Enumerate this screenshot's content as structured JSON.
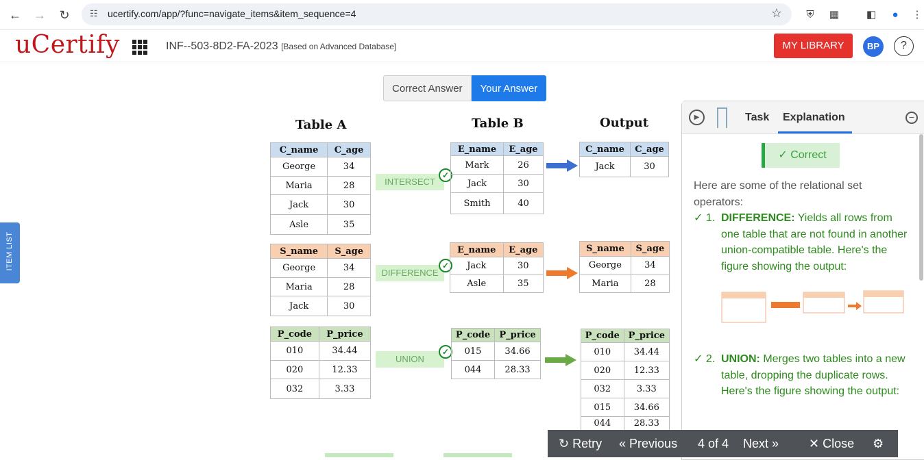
{
  "browser": {
    "url": "ucertify.com/app/?func=navigate_items&item_sequence=4"
  },
  "header": {
    "logo": "uCertify",
    "course_code": "INF--503-8D2-FA-2023",
    "course_note": "[Based on Advanced Database]",
    "my_library": "MY LIBRARY",
    "avatar": "BP",
    "help": "?"
  },
  "sidebar": {
    "item_list": "ITEM LIST"
  },
  "toggle": {
    "correct_answer": "Correct Answer",
    "your_answer": "Your Answer"
  },
  "diagram": {
    "titles": {
      "a": "Table A",
      "b": "Table B",
      "out": "Output"
    },
    "intersect": {
      "op": "INTERSECT",
      "a": {
        "headers": [
          "C_name",
          "C_age"
        ],
        "rows": [
          [
            "George",
            "34"
          ],
          [
            "Maria",
            "28"
          ],
          [
            "Jack",
            "30"
          ],
          [
            "Asle",
            "35"
          ]
        ]
      },
      "b": {
        "headers": [
          "E_name",
          "E_age"
        ],
        "rows": [
          [
            "Mark",
            "26"
          ],
          [
            "Jack",
            "30"
          ],
          [
            "Smith",
            "40"
          ]
        ]
      },
      "out": {
        "headers": [
          "C_name",
          "C_age"
        ],
        "rows": [
          [
            "Jack",
            "30"
          ]
        ]
      }
    },
    "difference": {
      "op": "DIFFERENCE",
      "a": {
        "headers": [
          "S_name",
          "S_age"
        ],
        "rows": [
          [
            "George",
            "34"
          ],
          [
            "Maria",
            "28"
          ],
          [
            "Jack",
            "30"
          ]
        ]
      },
      "b": {
        "headers": [
          "E_name",
          "E_age"
        ],
        "rows": [
          [
            "Jack",
            "30"
          ],
          [
            "Asle",
            "35"
          ]
        ]
      },
      "out": {
        "headers": [
          "S_name",
          "S_age"
        ],
        "rows": [
          [
            "George",
            "34"
          ],
          [
            "Maria",
            "28"
          ]
        ]
      }
    },
    "union": {
      "op": "UNION",
      "a": {
        "headers": [
          "P_code",
          "P_price"
        ],
        "rows": [
          [
            "010",
            "34.44"
          ],
          [
            "020",
            "12.33"
          ],
          [
            "032",
            "3.33"
          ]
        ]
      },
      "b": {
        "headers": [
          "P_code",
          "P_price"
        ],
        "rows": [
          [
            "015",
            "34.66"
          ],
          [
            "044",
            "28.33"
          ]
        ]
      },
      "out": {
        "headers": [
          "P_code",
          "P_price"
        ],
        "rows": [
          [
            "010",
            "34.44"
          ],
          [
            "020",
            "12.33"
          ],
          [
            "032",
            "3.33"
          ],
          [
            "015",
            "34.66"
          ],
          [
            "044",
            "28.33"
          ]
        ]
      }
    }
  },
  "panel": {
    "tab_task": "Task",
    "tab_explanation": "Explanation",
    "correct_badge": "Correct",
    "intro": "Here are some of the relational set operators:",
    "items": [
      {
        "num": "1.",
        "term": "DIFFERENCE:",
        "text": "Yields all rows from one table that are not found in another union-compatible table. Here's the figure showing the output:"
      },
      {
        "num": "2.",
        "term": "UNION:",
        "text": "Merges two tables into a new table, dropping the duplicate rows. Here's the figure showing the output:"
      }
    ]
  },
  "bottombar": {
    "retry": "Retry",
    "previous": "Previous",
    "position": "4 of 4",
    "next": "Next",
    "close": "Close"
  },
  "colors": {
    "brand_red": "#c0171d",
    "accent_blue": "#1e7ae8",
    "correct_green": "#2e8b1d"
  }
}
